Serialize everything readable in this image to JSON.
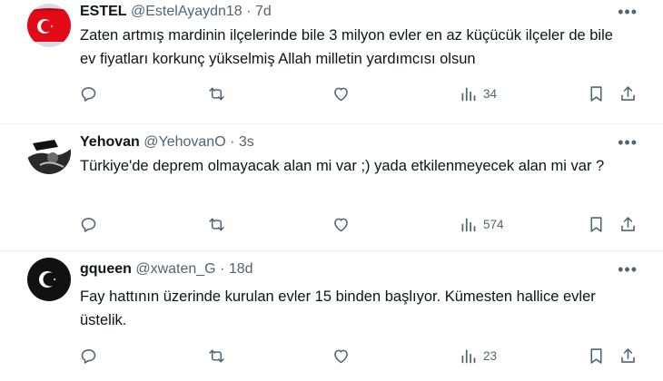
{
  "tweets": [
    {
      "name": "ESTEL",
      "handle": "@EstelAyaydn18",
      "sep": "·",
      "time": "7d",
      "text": "Zaten artmış mardinin ilçelerinde bile 3 milyon evler en az küçücük ilçeler de bile ev fiyatları korkunç yükselmiş Allah milletin yardımcısı olsun",
      "views": "34",
      "avatar_icon": "turkish-flag-avatar"
    },
    {
      "name": "Yehovan",
      "handle": "@YehovanO",
      "sep": "·",
      "time": "3s",
      "text": "Türkiye'de deprem olmayacak alan mi var ;) yada etkilenmeyecek alan mi var ?",
      "views": "574",
      "avatar_icon": "bw-profile-avatar"
    },
    {
      "name": "gqueen",
      "handle": "@xwaten_G",
      "sep": "·",
      "time": "18d",
      "text": "Fay hattının üzerinde kurulan evler 15 binden başlıyor. Kümesten hallice evler üstelik.",
      "views": "23",
      "avatar_icon": "crescent-star-avatar"
    }
  ],
  "more_glyph": "•••",
  "colors": {
    "text": "#0f1419",
    "secondary": "#536471",
    "divider": "#eff3f4",
    "flag_red": "#e30a17"
  }
}
